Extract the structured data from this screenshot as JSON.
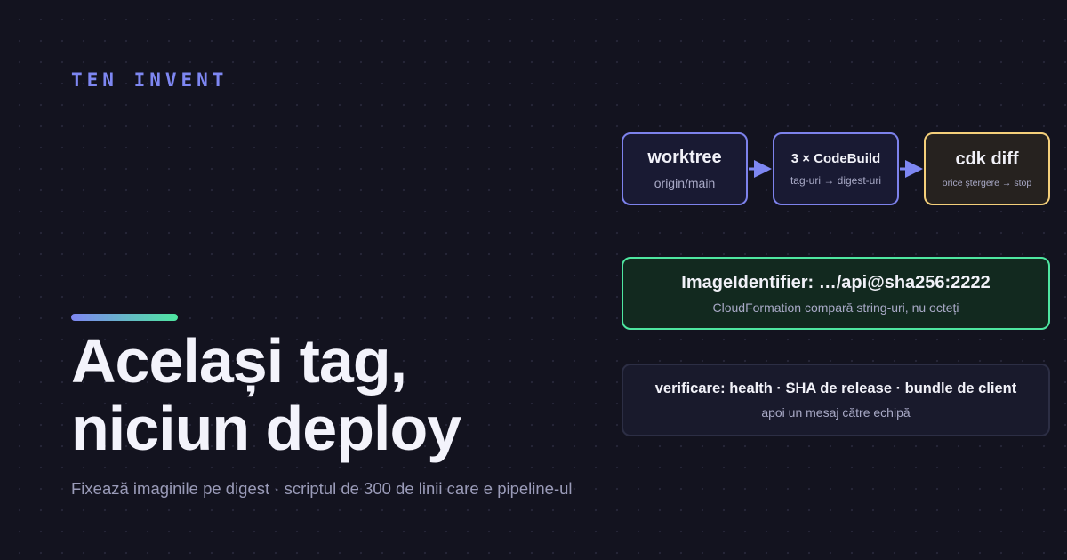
{
  "brand": "TEN INVENT",
  "colors": {
    "background": "#13131f",
    "accent_blue": "#7e87f2",
    "accent_green": "#4ee6a0",
    "accent_yellow": "#f4cf7a"
  },
  "headline": {
    "line1": "Același tag,",
    "line2": "niciun deploy"
  },
  "subtitle": "Fixează imaginile pe digest · scriptul de 300 de linii care e pipeline-ul",
  "flow": [
    {
      "title": "worktree",
      "subtitle": "origin/main"
    },
    {
      "title": "3 × CodeBuild",
      "subtitle": "tag-uri → digest-uri"
    },
    {
      "title": "cdk diff",
      "subtitle": "orice ștergere → stop"
    }
  ],
  "image_identifier": {
    "title": "ImageIdentifier: …/api@sha256:2222",
    "subtitle": "CloudFormation compară string-uri, nu octeți"
  },
  "verification": {
    "title": "verificare: health · SHA de release · bundle de client",
    "subtitle": "apoi un mesaj către echipă"
  },
  "icons": [
    "arrow-right-icon"
  ]
}
